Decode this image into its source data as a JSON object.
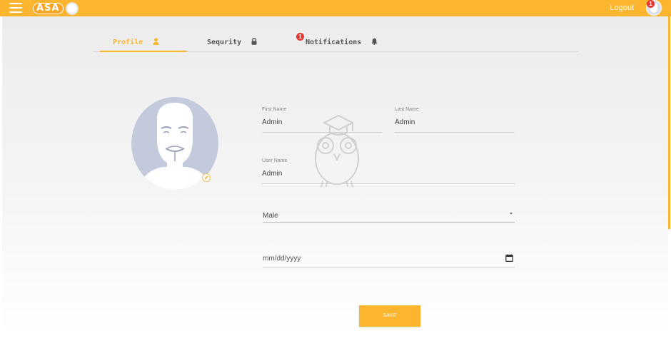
{
  "header": {
    "logo_text": "ASA",
    "logout_label": "Logout",
    "notification_count": "1"
  },
  "tabs": [
    {
      "label": "Profile",
      "icon": "user-icon",
      "active": true
    },
    {
      "label": "Sequrity",
      "icon": "lock-icon",
      "active": false
    },
    {
      "label": "Notifications",
      "icon": "bell-icon",
      "active": false,
      "badge": "1"
    }
  ],
  "profile": {
    "first_name": {
      "label": "First Name",
      "value": "Admin"
    },
    "last_name": {
      "label": "Last Name",
      "value": "Admin"
    },
    "user_name": {
      "label": "User Name",
      "value": "Admin"
    },
    "gender": {
      "value": "Male"
    },
    "birth_date": {
      "placeholder": "mm/dd/yyyy"
    }
  },
  "save_label": "SAVE",
  "colors": {
    "accent": "#fbb52f",
    "badge": "#e53935",
    "avatar_bg": "#c3cadc"
  }
}
